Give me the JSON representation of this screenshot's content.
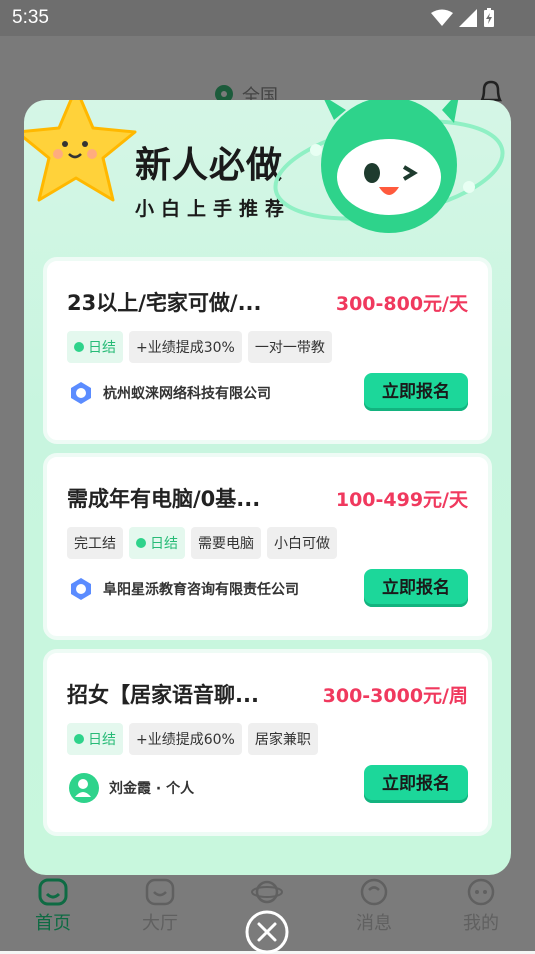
{
  "status_bar": {
    "time": "5:35"
  },
  "background": {
    "location": "全国",
    "tabs": [
      {
        "label": "首页",
        "icon": "home-icon"
      },
      {
        "label": "大厅",
        "icon": "hall-icon"
      },
      {
        "label": "",
        "icon": "planet-icon"
      },
      {
        "label": "消息",
        "icon": "message-icon"
      },
      {
        "label": "我的",
        "icon": "profile-icon"
      }
    ]
  },
  "modal": {
    "title": "新人必做",
    "subtitle": "小白上手推荐",
    "jobs": [
      {
        "title": "23以上/宅家可做/...",
        "salary": "300-800元/天",
        "tags": [
          {
            "text": "日结",
            "highlight": true
          },
          {
            "text": "+业绩提成30%",
            "highlight": false
          },
          {
            "text": "一对一带教",
            "highlight": false
          }
        ],
        "company": "杭州蚁涞网络科技有限公司",
        "apply": "立即报名"
      },
      {
        "title": "需成年有电脑/0基...",
        "salary": "100-499元/天",
        "tags": [
          {
            "text": "完工结",
            "highlight": false
          },
          {
            "text": "日结",
            "highlight": true
          },
          {
            "text": "需要电脑",
            "highlight": false
          },
          {
            "text": "小白可做",
            "highlight": false
          }
        ],
        "company": "阜阳星泺教育咨询有限责任公司",
        "apply": "立即报名"
      },
      {
        "title": "招女【居家语音聊...",
        "salary": "300-3000元/周",
        "tags": [
          {
            "text": "日结",
            "highlight": true
          },
          {
            "text": "+业绩提成60%",
            "highlight": false
          },
          {
            "text": "居家兼职",
            "highlight": false
          }
        ],
        "company": "刘金霞 · 个人",
        "apply": "立即报名"
      }
    ]
  },
  "colors": {
    "accent": "#1cd79a",
    "salary": "#f0395e",
    "modal_bg": "#c8f5df"
  }
}
